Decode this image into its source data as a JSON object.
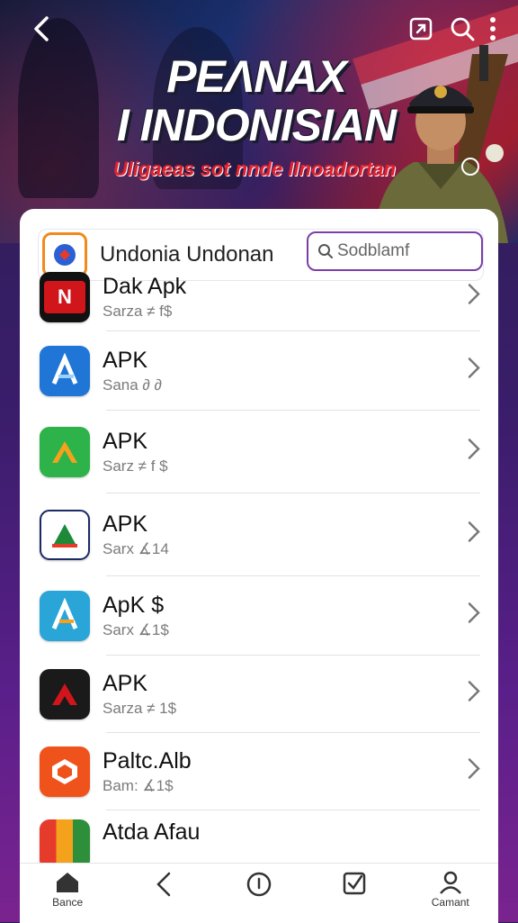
{
  "hero": {
    "title_line1": "PEΛNAX",
    "title_line2": "I INDONISIAN",
    "subtitle": "Uligaeas sot nnde Ilnoadortan"
  },
  "header": {
    "app_title": "Undonia Undonan",
    "search_placeholder": "Sodblamf"
  },
  "apps": [
    {
      "title": "Dak Apk",
      "sub": "Sarza ≠ f$",
      "icon": "red-logo-icon",
      "color": "#d0151b"
    },
    {
      "title": "APK",
      "sub": "Sana ∂ ∂",
      "icon": "blue-a-logo-icon",
      "color": "#1f76d6"
    },
    {
      "title": "APK",
      "sub": "Sarz ≠ f $",
      "icon": "green-triangle-logo-icon",
      "color": "#2db34a"
    },
    {
      "title": "APK",
      "sub": "Sarx ∡14",
      "icon": "green-emblem-logo-icon",
      "color": "#1d8a3a"
    },
    {
      "title": "ApK $",
      "sub": "Sarx ∡1$",
      "icon": "cyan-a-logo-icon",
      "color": "#2aa5d8"
    },
    {
      "title": "APK",
      "sub": "Sarza ≠ 1$",
      "icon": "black-red-logo-icon",
      "color": "#1a1a1a"
    },
    {
      "title": "Paltc.Alb",
      "sub": "Bam: ∡1$",
      "icon": "orange-shield-logo-icon",
      "color": "#f0521c"
    },
    {
      "title": "Atda Afau",
      "sub": "",
      "icon": "multicolor-logo-icon",
      "color": "#2d8f3a"
    }
  ],
  "nav": {
    "home": "Bance",
    "account": "Camant"
  }
}
